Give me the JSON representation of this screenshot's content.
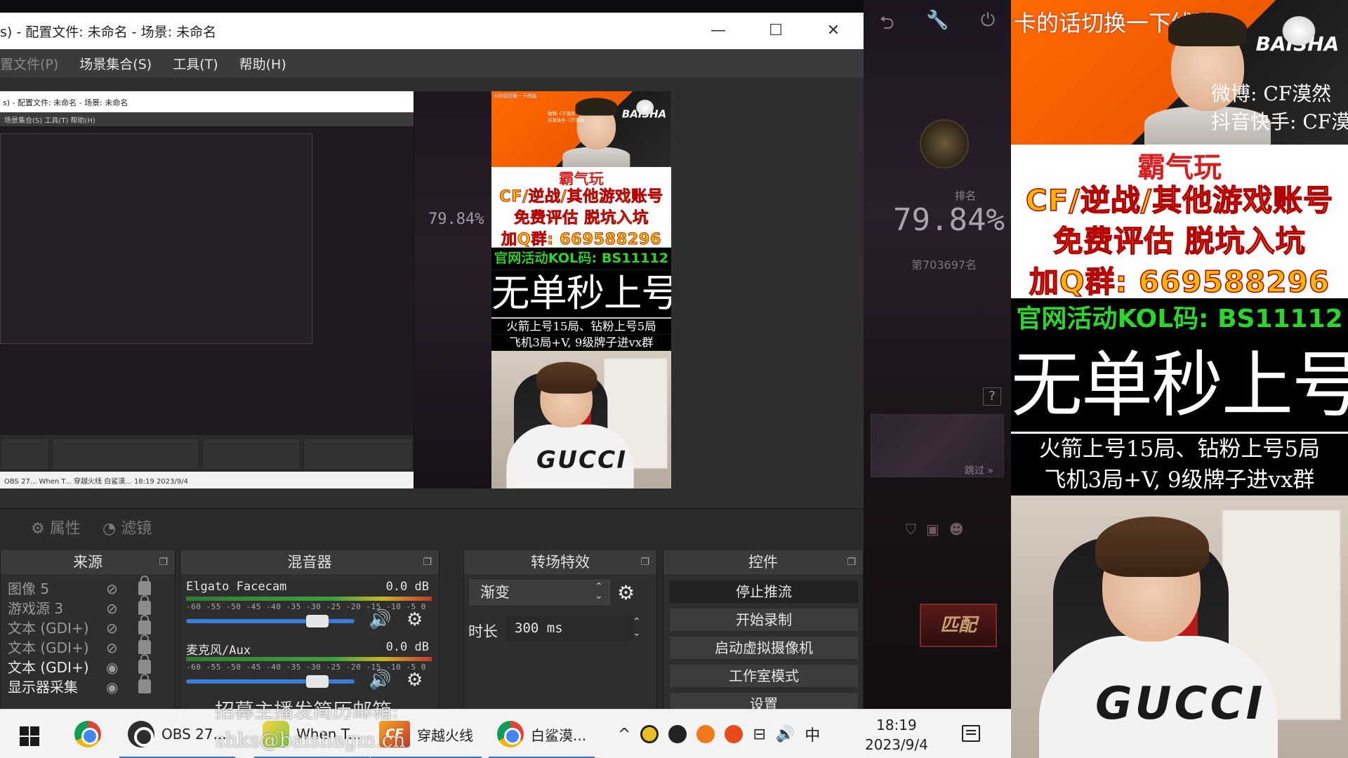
{
  "obs": {
    "title": "s) - 配置文件: 未命名 - 场景: 未命名",
    "window_controls": {
      "minimize": "—",
      "maximize": "☐",
      "close": "✕"
    },
    "menu": [
      {
        "label": "置文件(P)",
        "dim": true
      },
      {
        "label": "场景集合(S)"
      },
      {
        "label": "工具(T)"
      },
      {
        "label": "帮助(H)"
      }
    ],
    "toolbar": {
      "properties": "属性",
      "filters": "滤镜"
    },
    "sources": {
      "title": "来源",
      "items": [
        {
          "label": "图像 5",
          "visible": false
        },
        {
          "label": "游戏源 3",
          "visible": false
        },
        {
          "label": "文本 (GDI+)",
          "visible": false
        },
        {
          "label": "文本 (GDI+)",
          "visible": false
        },
        {
          "label": "文本 (GDI+)",
          "visible": true
        },
        {
          "label": "显示器采集",
          "visible": true
        }
      ]
    },
    "mixer": {
      "title": "混音器",
      "channels": [
        {
          "name": "Elgato Facecam",
          "db": "0.0 dB",
          "level": 0.78
        },
        {
          "name": "麦克风/Aux",
          "db": "0.0 dB",
          "level": 0.78
        }
      ],
      "ticks": "-60 -55 -50 -45 -40 -35 -30 -25 -20 -15 -10  -5   0"
    },
    "transitions": {
      "title": "转场特效",
      "selected": "渐变",
      "duration_label": "时长",
      "duration_value": "300 ms"
    },
    "controls": {
      "title": "控件",
      "buttons": [
        "停止推流",
        "开始录制",
        "启动虚拟摄像机",
        "工作室模式",
        "设置"
      ]
    }
  },
  "nested": {
    "title": "s) - 配置文件: 未命名 - 场景: 未命名",
    "menu": "场景集合(S)   工具(T)   帮助(H)",
    "taskbar": "OBS 27...   When T...   穿越火线   白鲨漠...        18:19  2023/9/4",
    "percent": "79.84%"
  },
  "game": {
    "rank_label": "排名",
    "percent": "79.84%",
    "rank_num": "第703697名",
    "question": "?",
    "next": "跳过 »",
    "match": "匹配"
  },
  "taskbar": {
    "apps": [
      {
        "label": "OBS 27...",
        "icon": "obs-icon"
      },
      {
        "label": "When T...",
        "icon": "when-icon"
      },
      {
        "label": "穿越火线",
        "icon": "crossfire-icon"
      },
      {
        "label": "白鲨漠...",
        "icon": "chrome-icon"
      }
    ],
    "tray": {
      "up_arrow": "^",
      "volume": "🔊",
      "ime": "中"
    },
    "time": "18:19",
    "date": "2023/9/4"
  },
  "watermark": {
    "line1": "招募主播发简历邮箱:",
    "line2": "shks@baishagm.cn"
  },
  "ad": {
    "header": "卡的话切换一下线路",
    "logo": "BAISHA",
    "weibo": "微博: CF漠然",
    "douyin": "抖音快手: CF漠然",
    "brand": "霸气玩",
    "line1": "CF/逆战/其他游戏账号",
    "line2": "免费评估 脱坑入坑",
    "line3": "加Q群: 669588296",
    "kol": "官网活动KOL码: BS11112",
    "big": "无单秒上号",
    "small1": "火箭上号15局、钻粉上号5局",
    "small2": "飞机3局+V, 9级牌子进vx群",
    "shirt": "GUCCI"
  }
}
